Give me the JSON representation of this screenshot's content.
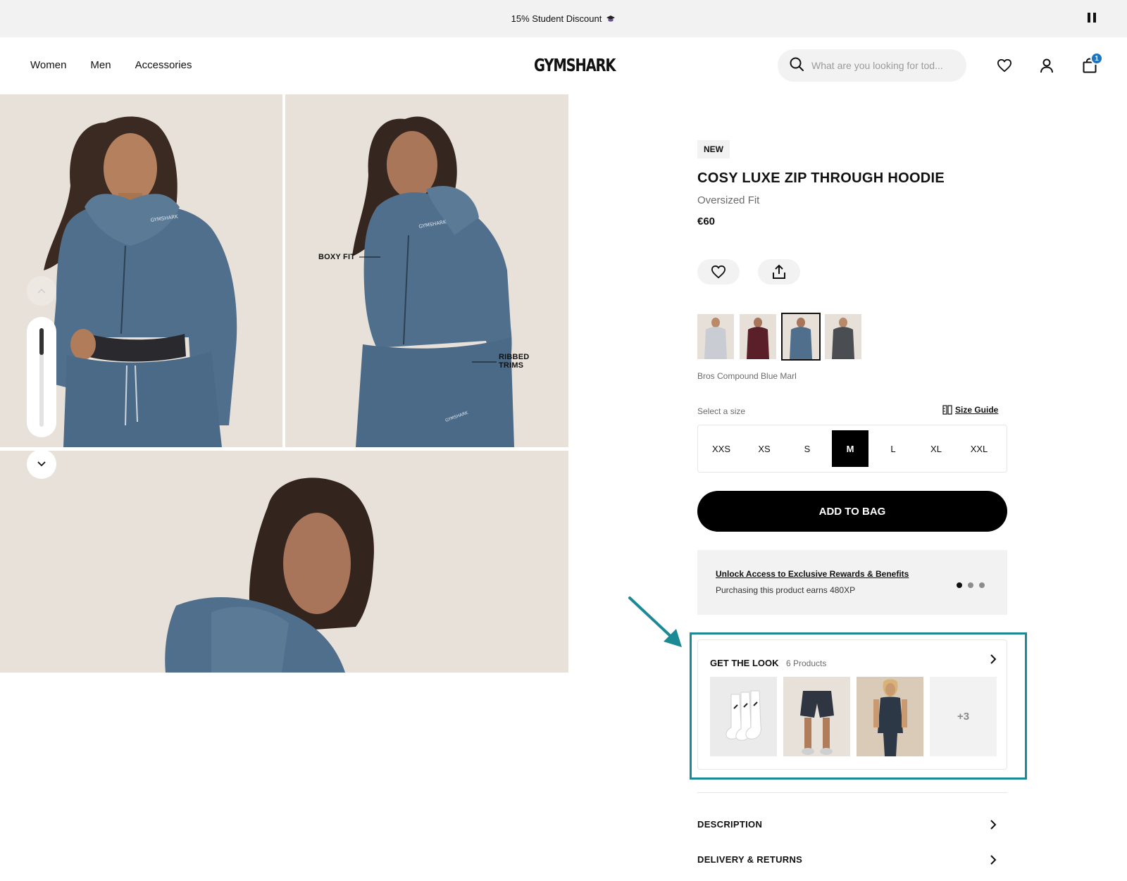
{
  "announcement": {
    "text": "15% Student Discount"
  },
  "nav": {
    "items": [
      "Women",
      "Men",
      "Accessories"
    ]
  },
  "brand": {
    "logo": "GYMSHARK"
  },
  "search": {
    "placeholder": "What are you looking for tod..."
  },
  "cart": {
    "count": "1"
  },
  "gallery": {
    "callouts": {
      "boxy_fit": "BOXY FIT",
      "ribbed_line1": "RIBBED",
      "ribbed_line2": "TRIMS"
    },
    "print": "GYMSHARK"
  },
  "product": {
    "badge": "NEW",
    "title": "COSY LUXE ZIP THROUGH HOODIE",
    "fit": "Oversized Fit",
    "price": "€60",
    "color_name": "Bros Compound Blue Marl",
    "size_label": "Select a size",
    "size_guide": "Size Guide",
    "sizes": [
      "XXS",
      "XS",
      "S",
      "M",
      "L",
      "XL",
      "XXL"
    ],
    "selected_size": "M",
    "add_to_bag": "ADD TO BAG"
  },
  "rewards": {
    "title": "Unlock Access to Exclusive Rewards & Benefits",
    "subtitle": "Purchasing this product earns 480XP"
  },
  "get_the_look": {
    "title": "GET THE LOOK",
    "count": "6 Products",
    "more": "+3"
  },
  "accordions": {
    "description": "DESCRIPTION",
    "delivery": "DELIVERY & RETURNS"
  },
  "colors": {
    "accent_badge": "#1e73be",
    "highlight": "#1b8a94",
    "hoodie": "#4f6f8c",
    "backdrop": "#e6e0d8"
  }
}
